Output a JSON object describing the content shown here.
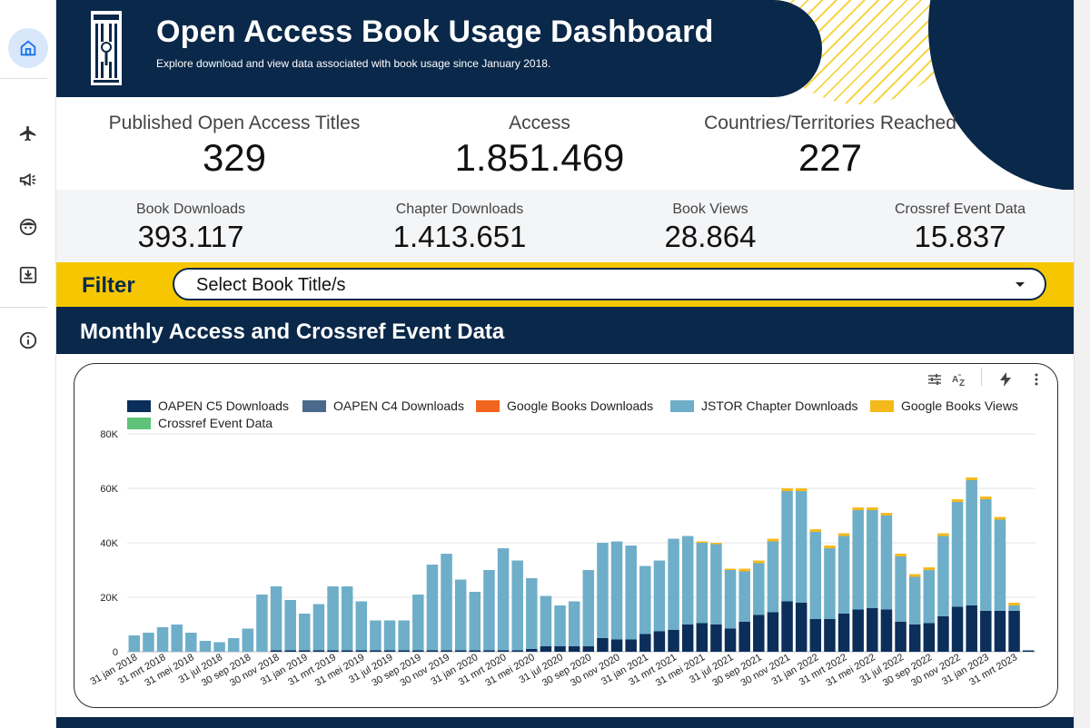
{
  "header": {
    "title": "Open Access Book Usage Dashboard",
    "subtitle": "Explore download and view data associated with book usage since January 2018."
  },
  "kpis_primary": [
    {
      "label": "Published Open Access Titles",
      "value": "329"
    },
    {
      "label": "Access",
      "value": "1.851.469"
    },
    {
      "label": "Countries/Territories Reached",
      "value": "227"
    }
  ],
  "kpis_secondary": [
    {
      "label": "Book Downloads",
      "value": "393.117"
    },
    {
      "label": "Chapter Downloads",
      "value": "1.413.651"
    },
    {
      "label": "Book Views",
      "value": "28.864"
    },
    {
      "label": "Crossref Event Data",
      "value": "15.837"
    }
  ],
  "filter": {
    "label": "Filter",
    "placeholder": "Select Book Title/s"
  },
  "section": {
    "title": "Monthly Access and Crossref Event Data"
  },
  "nav": {
    "icons": [
      "home-icon",
      "airplane-icon",
      "megaphone-icon",
      "face-icon",
      "download-box-icon",
      "info-icon"
    ]
  },
  "colors": {
    "navy": "#0a2849",
    "accent_yellow": "#f6c700",
    "oapen_c5": "#0b2e5a",
    "oapen_c4": "#4a6a8c",
    "google_downloads": "#f2651f",
    "jstor": "#6eaec9",
    "google_views": "#f4b91b",
    "crossref": "#5fc27a"
  },
  "chart_data": {
    "type": "bar",
    "stacked": true,
    "title": "",
    "xlabel": "",
    "ylabel": "",
    "ylim": [
      0,
      80000
    ],
    "yticks": [
      0,
      20000,
      40000,
      60000,
      80000
    ],
    "ytick_labels": [
      "0",
      "20K",
      "40K",
      "60K",
      "80K"
    ],
    "grid": true,
    "legend_position": "top",
    "x_tick_labels": [
      "31 jan 2018",
      "31 mrt 2018",
      "31 mei 2018",
      "31 jul 2018",
      "30 sep 2018",
      "30 nov 2018",
      "31 jan 2019",
      "31 mrt 2019",
      "31 mei 2019",
      "31 jul 2019",
      "30 sep 2019",
      "30 nov 2019",
      "31 jan 2020",
      "31 mrt 2020",
      "31 mei 2020",
      "31 jul 2020",
      "30 sep 2020",
      "30 nov 2020",
      "31 jan 2021",
      "31 mrt 2021",
      "31 mei 2021",
      "31 jul 2021",
      "30 sep 2021",
      "30 nov 2021",
      "31 jan 2022",
      "31 mrt 2022",
      "31 mei 2022",
      "31 jul 2022",
      "30 sep 2022",
      "30 nov 2022",
      "31 jan 2023",
      "31 mrt 2023"
    ],
    "categories": [
      "2018-01",
      "2018-02",
      "2018-03",
      "2018-04",
      "2018-05",
      "2018-06",
      "2018-07",
      "2018-08",
      "2018-09",
      "2018-10",
      "2018-11",
      "2018-12",
      "2019-01",
      "2019-02",
      "2019-03",
      "2019-04",
      "2019-05",
      "2019-06",
      "2019-07",
      "2019-08",
      "2019-09",
      "2019-10",
      "2019-11",
      "2019-12",
      "2020-01",
      "2020-02",
      "2020-03",
      "2020-04",
      "2020-05",
      "2020-06",
      "2020-07",
      "2020-08",
      "2020-09",
      "2020-10",
      "2020-11",
      "2020-12",
      "2021-01",
      "2021-02",
      "2021-03",
      "2021-04",
      "2021-05",
      "2021-06",
      "2021-07",
      "2021-08",
      "2021-09",
      "2021-10",
      "2021-11",
      "2021-12",
      "2022-01",
      "2022-02",
      "2022-03",
      "2022-04",
      "2022-05",
      "2022-06",
      "2022-07",
      "2022-08",
      "2022-09",
      "2022-10",
      "2022-11",
      "2022-12",
      "2023-01",
      "2023-02",
      "2023-03",
      "2023-04"
    ],
    "series": [
      {
        "name": "OAPEN C5 Downloads",
        "color": "#0b2e5a",
        "values": [
          0,
          0,
          0,
          0,
          0,
          0,
          0,
          0,
          0,
          0,
          500,
          500,
          500,
          500,
          500,
          500,
          500,
          500,
          500,
          500,
          500,
          500,
          500,
          500,
          500,
          500,
          500,
          500,
          1000,
          2000,
          2000,
          2000,
          2000,
          5000,
          4500,
          4500,
          6500,
          7500,
          8000,
          10000,
          10500,
          10000,
          8500,
          11000,
          13500,
          14500,
          18500,
          18000,
          12000,
          12000,
          14000,
          15500,
          16000,
          15500,
          11000,
          10000,
          10500,
          13000,
          16500,
          17000,
          15000,
          15000,
          15000,
          500
        ]
      },
      {
        "name": "OAPEN C4 Downloads",
        "color": "#4a6a8c",
        "values": [
          0,
          0,
          0,
          0,
          0,
          0,
          0,
          0,
          0,
          0,
          0,
          0,
          0,
          0,
          0,
          0,
          0,
          0,
          0,
          0,
          0,
          0,
          0,
          0,
          0,
          0,
          0,
          0,
          0,
          0,
          0,
          0,
          0,
          0,
          0,
          0,
          0,
          0,
          0,
          0,
          0,
          0,
          0,
          0,
          0,
          0,
          0,
          0,
          0,
          0,
          0,
          0,
          0,
          0,
          0,
          0,
          0,
          0,
          0,
          0,
          0,
          0,
          0,
          0
        ]
      },
      {
        "name": "Google Books Downloads",
        "color": "#f2651f",
        "values": [
          0,
          0,
          0,
          0,
          0,
          0,
          0,
          0,
          0,
          0,
          0,
          0,
          0,
          0,
          0,
          0,
          0,
          0,
          0,
          0,
          0,
          0,
          0,
          0,
          0,
          0,
          0,
          0,
          0,
          0,
          0,
          0,
          0,
          0,
          0,
          0,
          0,
          0,
          0,
          0,
          0,
          0,
          0,
          0,
          0,
          0,
          0,
          0,
          0,
          0,
          0,
          0,
          0,
          0,
          0,
          0,
          0,
          0,
          0,
          0,
          0,
          0,
          0,
          0
        ]
      },
      {
        "name": "JSTOR Chapter Downloads",
        "color": "#6eaec9",
        "values": [
          6000,
          7000,
          9000,
          10000,
          7000,
          4000,
          3500,
          5000,
          8500,
          21000,
          23500,
          18500,
          13500,
          17000,
          23500,
          23500,
          18000,
          11000,
          11000,
          11000,
          20500,
          31500,
          35500,
          26000,
          21500,
          29500,
          37500,
          33000,
          26000,
          18500,
          15000,
          16500,
          28000,
          35000,
          36000,
          34500,
          25000,
          26000,
          33500,
          32500,
          29500,
          29500,
          21500,
          18500,
          19000,
          26000,
          40500,
          41000,
          32000,
          26000,
          28500,
          36500,
          36000,
          34500,
          24000,
          17500,
          19500,
          29500,
          38500,
          46000,
          41000,
          33500,
          2000,
          0
        ]
      },
      {
        "name": "Google Books Views",
        "color": "#f4b91b",
        "values": [
          0,
          0,
          0,
          0,
          0,
          0,
          0,
          0,
          0,
          0,
          0,
          0,
          0,
          0,
          0,
          0,
          0,
          0,
          0,
          0,
          0,
          0,
          0,
          0,
          0,
          0,
          0,
          0,
          0,
          0,
          0,
          0,
          0,
          0,
          0,
          0,
          0,
          0,
          0,
          0,
          500,
          500,
          500,
          1000,
          1000,
          1000,
          1000,
          1000,
          1000,
          1000,
          1000,
          1000,
          1000,
          1000,
          1000,
          1000,
          1000,
          1000,
          1000,
          1000,
          1000,
          1000,
          1000,
          0
        ]
      },
      {
        "name": "Crossref Event Data",
        "color": "#5fc27a",
        "values": [
          0,
          0,
          0,
          0,
          0,
          0,
          0,
          0,
          0,
          0,
          0,
          0,
          0,
          0,
          0,
          0,
          0,
          0,
          0,
          0,
          0,
          0,
          0,
          0,
          0,
          0,
          0,
          0,
          0,
          0,
          0,
          0,
          0,
          0,
          0,
          0,
          0,
          0,
          0,
          0,
          0,
          0,
          0,
          0,
          0,
          0,
          0,
          0,
          0,
          0,
          0,
          0,
          0,
          0,
          0,
          0,
          0,
          0,
          0,
          0,
          0,
          0,
          0,
          0
        ]
      }
    ]
  }
}
